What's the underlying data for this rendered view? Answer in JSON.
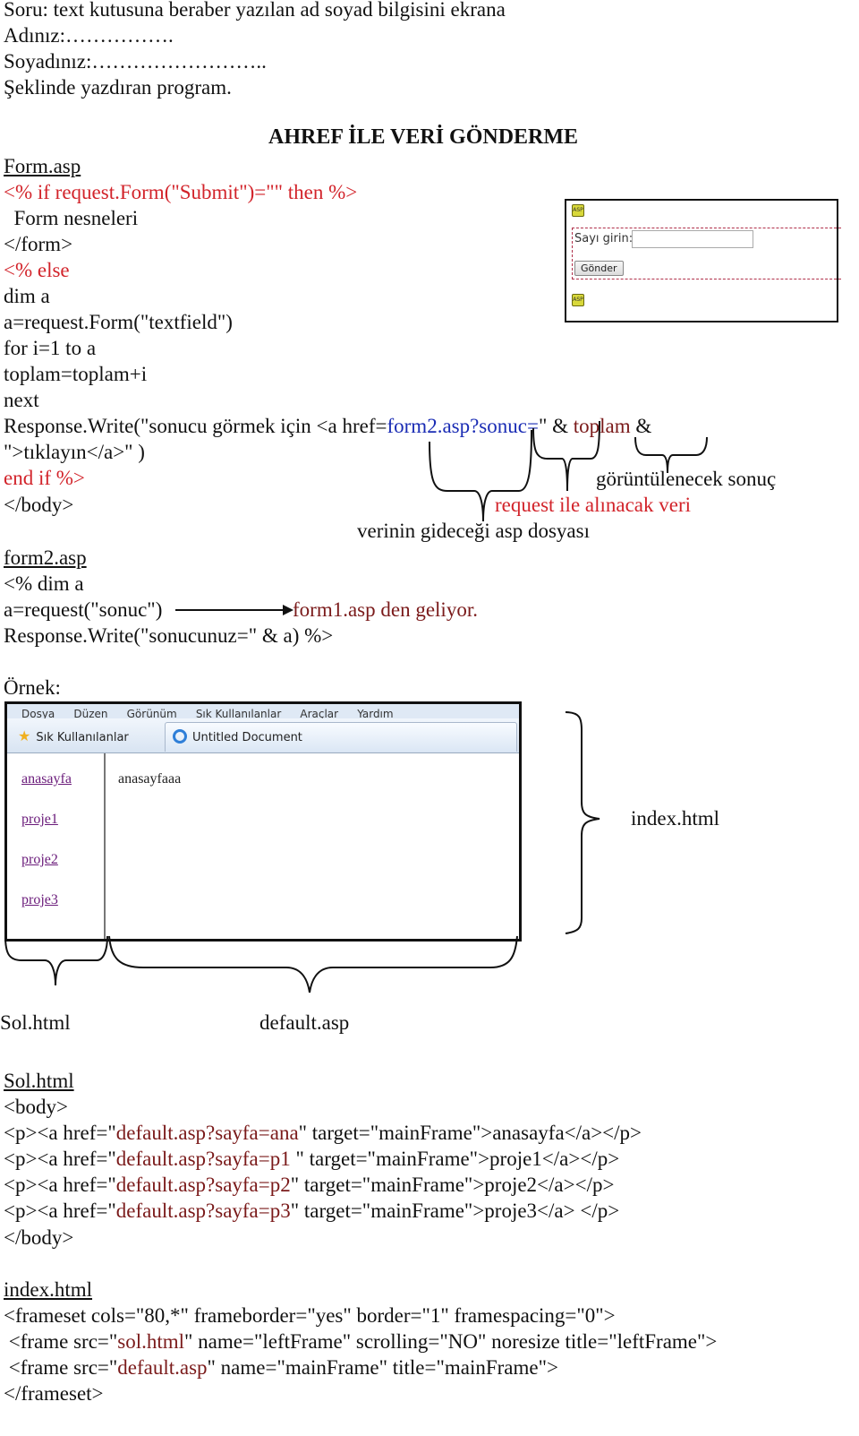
{
  "question": {
    "line1": "Soru: text kutusuna beraber yazılan ad soyad bilgisini ekrana",
    "line2": "Adınız:…………….",
    "line3": "Soyadınız:……………………..",
    "line4": "Şeklinde yazdıran program."
  },
  "section_title": "AHREF İLE VERİ GÖNDERME",
  "form_asp": {
    "filename": "Form.asp",
    "lines": [
      "<% if request.Form(\"Submit\")=\"\" then %>",
      "  Form nesneleri",
      "</form>",
      "<% else",
      "dim a",
      "a=request.Form(\"textfield\")",
      "for i=1 to a",
      "toplam=toplam+i",
      "next"
    ],
    "write_prefix": "Response.Write(\"sonucu görmek için <a href=",
    "write_link": "form2.asp?sonuc=",
    "write_mid": "\" & ",
    "write_var": "toplam",
    "write_end": " &",
    "write_line2": "\">tıklayın</a>\" )",
    "end_if": "end if %>",
    "end_body": "</body>"
  },
  "annotations": {
    "result": "görüntülenecek sonuç",
    "request_data": "request ile alınacak veri",
    "target_file": "verinin gideceği asp dosyası",
    "from_form1": "form1.asp den geliyor."
  },
  "form_preview": {
    "label": "Sayı girin:",
    "input_value": "",
    "button": "Gönder",
    "icon": "asp-icon"
  },
  "form2_asp": {
    "filename": "form2.asp",
    "line1": "<% dim a",
    "line2": "a=request(\"sonuc\")",
    "line3": "Response.Write(\"sonucunuz=\" & a) %>"
  },
  "example": {
    "label": "Örnek:",
    "browser": {
      "menu": [
        "Dosya",
        "Düzen",
        "Görünüm",
        "Sık Kullanılanlar",
        "Araçlar",
        "Yardım"
      ],
      "favorites": "Sık Kullanılanlar",
      "tab_title": "Untitled Document",
      "left_links": [
        "anasayfa",
        "proje1",
        "proje2",
        "proje3"
      ],
      "main_text": "anasayfaaa"
    },
    "brace_index": "index.html",
    "brace_sol": "Sol.html",
    "brace_default": "default.asp"
  },
  "sol_html": {
    "filename": "Sol.html",
    "open": "<body>",
    "rows": [
      {
        "pre": "<p><a href=\"",
        "href": "default.asp?sayfa=ana",
        "post": "\" target=\"mainFrame\">anasayfa</a></p>"
      },
      {
        "pre": "<p><a href=\"",
        "href": "default.asp?sayfa=p1",
        "post": " \" target=\"mainFrame\">proje1</a></p>"
      },
      {
        "pre": "<p><a href=\"",
        "href": "default.asp?sayfa=p2",
        "post": "\" target=\"mainFrame\">proje2</a></p>"
      },
      {
        "pre": "<p><a href=\"",
        "href": "default.asp?sayfa=p3",
        "post": "\" target=\"mainFrame\">proje3</a> </p>"
      }
    ],
    "close": "</body>"
  },
  "index_html": {
    "filename": "index.html",
    "line1": "<frameset cols=\"80,*\" frameborder=\"yes\" border=\"1\" framespacing=\"0\">",
    "line2_pre": " <frame src=\"",
    "line2_src": "sol.html",
    "line2_post": "\" name=\"leftFrame\" scrolling=\"NO\" noresize title=\"leftFrame\">",
    "line3_pre": " <frame src=\"",
    "line3_src": "default.asp",
    "line3_post": "\" name=\"mainFrame\" title=\"mainFrame\">",
    "line4": "</frameset>"
  }
}
